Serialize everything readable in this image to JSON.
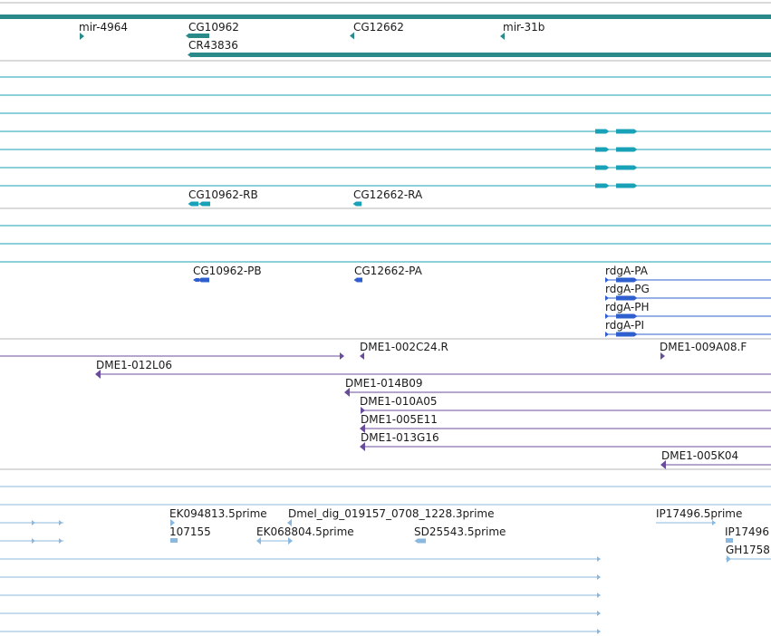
{
  "colors": {
    "gene": "#2a8a8a",
    "transcript": "#19a1b8",
    "protein": "#2f5fcf",
    "clone": "#6a4c9c",
    "est": "#8ab8de",
    "separator": "#b5b5b5",
    "label": "#1a1a1a"
  },
  "labels": {
    "gene_mir4964": "mir-4964",
    "gene_cg10962": "CG10962",
    "gene_cg12662": "CG12662",
    "gene_mir31b": "mir-31b",
    "gene_cr43836": "CR43836",
    "tx_cg10962_rb": "CG10962-RB",
    "tx_cg12662_ra": "CG12662-RA",
    "prot_cg10962_pb": "CG10962-PB",
    "prot_cg12662_pa": "CG12662-PA",
    "prot_rdga_pa": "rdgA-PA",
    "prot_rdga_pg": "rdgA-PG",
    "prot_rdga_ph": "rdgA-PH",
    "prot_rdga_pi": "rdgA-PI",
    "clone_002c24": "DME1-002C24.R",
    "clone_009a08": "DME1-009A08.F",
    "clone_012l06": "DME1-012L06",
    "clone_014b09": "DME1-014B09",
    "clone_010a05": "DME1-010A05",
    "clone_005e11": "DME1-005E11",
    "clone_013g16": "DME1-013G16",
    "clone_005k04": "DME1-005K04",
    "est_ek094813": "EK094813.5prime",
    "est_dmel_dig": "Dmel_dig_019157_0708_1228.3prime",
    "est_ip17496_5": "IP17496.5prime",
    "est_107155": "107155",
    "est_ek068804": "EK068804.5prime",
    "est_sd25543": "SD25543.5prime",
    "est_ip17496": "IP17496",
    "est_gh1758": "GH1758"
  }
}
